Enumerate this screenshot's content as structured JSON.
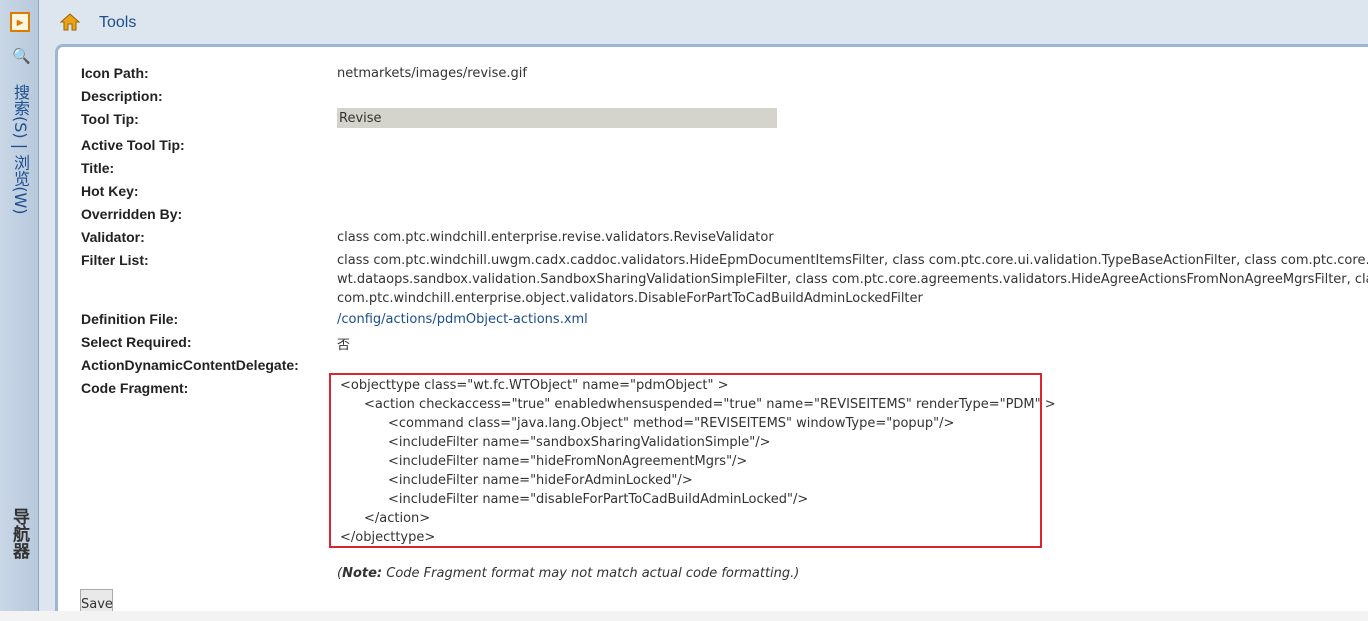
{
  "leftbar": {
    "search_browse": "搜索(S) | 浏览(W)",
    "navigator": "导航器",
    "expand_icon": "expand-arrow-icon",
    "search_icon": "search-icon"
  },
  "header": {
    "title": "Tools",
    "home_icon": "home-icon"
  },
  "fields": {
    "icon_path": {
      "label": "Icon Path:",
      "value": "netmarkets/images/revise.gif"
    },
    "description": {
      "label": "Description:",
      "value": ""
    },
    "tool_tip": {
      "label": "Tool Tip:",
      "value": "Revise"
    },
    "active_tool_tip": {
      "label": "Active Tool Tip:",
      "value": ""
    },
    "title": {
      "label": "Title:",
      "value": ""
    },
    "hot_key": {
      "label": "Hot Key:",
      "value": ""
    },
    "overridden_by": {
      "label": "Overridden By:",
      "value": ""
    },
    "validator": {
      "label": "Validator:",
      "value": "class com.ptc.windchill.enterprise.revise.validators.ReviseValidator"
    },
    "filter_list": {
      "label": "Filter List:",
      "lines": [
        "class com.ptc.windchill.uwgm.cadx.caddoc.validators.HideEpmDocumentItemsFilter, class com.ptc.core.ui.validation.TypeBaseActionFilter, class com.ptc.core.ui.valida",
        "wt.dataops.sandbox.validation.SandboxSharingValidationSimpleFilter, class com.ptc.core.agreements.validators.HideAgreeActionsFromNonAgreeMgrsFilter, class co",
        "com.ptc.windchill.enterprise.object.validators.DisableForPartToCadBuildAdminLockedFilter"
      ]
    },
    "definition_file": {
      "label": "Definition File:",
      "value": "/config/actions/pdmObject-actions.xml"
    },
    "select_required": {
      "label": "Select Required:",
      "value": "否"
    },
    "action_dynamic": {
      "label": "ActionDynamicContentDelegate:",
      "value": ""
    },
    "code_fragment": {
      "label": "Code Fragment:",
      "lines": [
        "<objecttype class=\"wt.fc.WTObject\" name=\"pdmObject\" >",
        "<action checkaccess=\"true\" enabledwhensuspended=\"true\" name=\"REVISEITEMS\" renderType=\"PDM\" >",
        "<command class=\"java.lang.Object\" method=\"REVISEITEMS\" windowType=\"popup\"/>",
        "<includeFilter name=\"sandboxSharingValidationSimple\"/>",
        "<includeFilter name=\"hideFromNonAgreementMgrs\"/>",
        "<includeFilter name=\"hideForAdminLocked\"/>",
        "<includeFilter name=\"disableForPartToCadBuildAdminLocked\"/>",
        "</action>",
        "</objecttype>"
      ]
    }
  },
  "note": {
    "prefix": "(",
    "bold": "Note:",
    "text": " Code Fragment format may not match actual code formatting.)"
  },
  "save_label": "Save",
  "colors": {
    "link": "#1d4f8f",
    "highlight_border": "#d9252f",
    "tooltip_bg": "#d4d4cc"
  }
}
